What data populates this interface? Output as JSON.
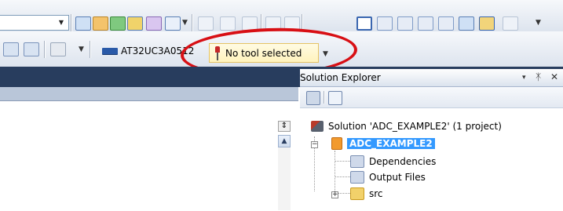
{
  "toolbar_top": {
    "combo_value": "",
    "icons": [
      "find-icon",
      "edit-icon",
      "run-icon",
      "chart-icon",
      "wand-icon",
      "window-icon",
      "outdent-icon",
      "indent-icon",
      "comment-icon",
      "uncomment-icon",
      "rect-icon",
      "bookmark-icon",
      "bookmark-prev-icon",
      "bookmark-next-icon",
      "bookmark-list-icon",
      "bookmark-clear-icon",
      "bookmark-go-icon",
      "zoom-icon"
    ]
  },
  "toolbar_device": {
    "device_name": "AT32UC3A0512",
    "tool_status": "No tool selected"
  },
  "colors": {
    "accent_selection": "#3399ff",
    "annotation_circle": "#d80f14",
    "tool_panel_bg": "#fff3bd",
    "dark_band": "#283d5e"
  },
  "solution_explorer": {
    "title": "Solution Explorer",
    "title_controls": {
      "dropdown": "▾",
      "pin": "ᛡ",
      "close": "✕"
    },
    "toolbar_icons": [
      "properties-icon",
      "show-files-icon"
    ],
    "solution_label": "Solution 'ADC_EXAMPLE2' (1 project)",
    "project_label": "ADC_EXAMPLE2",
    "children": [
      {
        "label": "Dependencies",
        "icon": "folder-ref-icon"
      },
      {
        "label": "Output Files",
        "icon": "folder-ref-icon"
      },
      {
        "label": "src",
        "icon": "folder-icon"
      }
    ]
  },
  "editor": {
    "split_button": "⇕",
    "scroll_up": "▲"
  }
}
